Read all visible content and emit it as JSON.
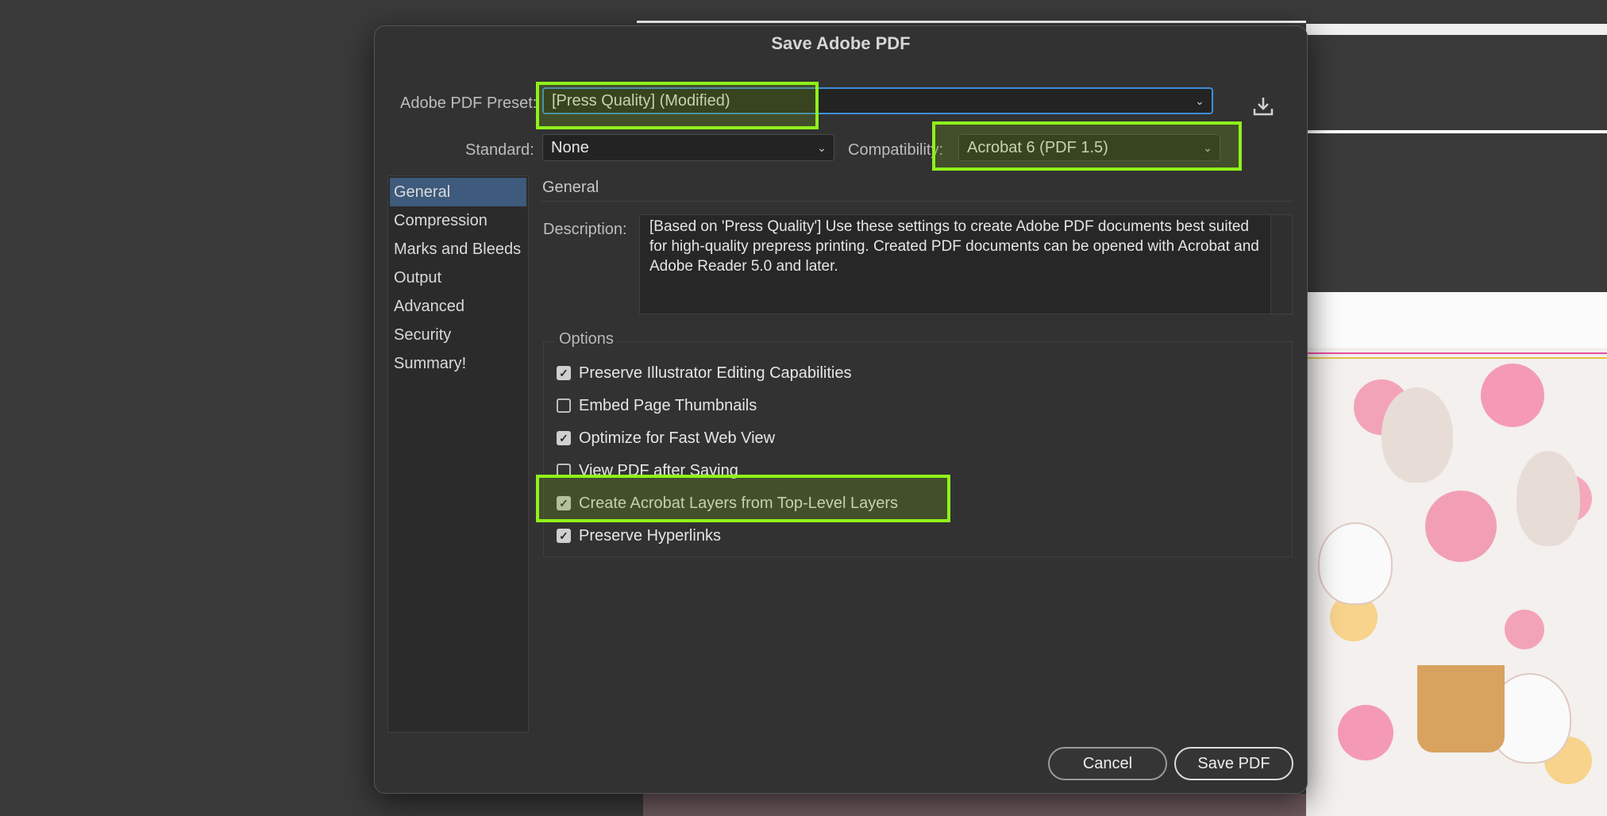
{
  "dialog": {
    "title": "Save Adobe PDF",
    "preset_label": "Adobe PDF Preset:",
    "preset_value": "[Press Quality] (Modified)",
    "standard_label": "Standard:",
    "standard_value": "None",
    "compatibility_label": "Compatibility:",
    "compatibility_value": "Acrobat 6 (PDF 1.5)",
    "save_preset_icon": "download-icon"
  },
  "sidebar": {
    "items": [
      {
        "label": "General",
        "active": true
      },
      {
        "label": "Compression"
      },
      {
        "label": "Marks and Bleeds"
      },
      {
        "label": "Output"
      },
      {
        "label": "Advanced"
      },
      {
        "label": "Security"
      },
      {
        "label": "Summary!"
      }
    ]
  },
  "main": {
    "section_title": "General",
    "description_label": "Description:",
    "description_text": "[Based on 'Press Quality'] Use these settings to create Adobe PDF documents best suited for high-quality prepress printing.  Created PDF documents can be opened with Acrobat and Adobe Reader 5.0 and later.",
    "options_title": "Options",
    "options": [
      {
        "label": "Preserve Illustrator Editing Capabilities",
        "checked": true
      },
      {
        "label": "Embed Page Thumbnails",
        "checked": false
      },
      {
        "label": "Optimize for Fast Web View",
        "checked": true
      },
      {
        "label": "View PDF after Saving",
        "checked": false
      },
      {
        "label": "Create Acrobat Layers from Top-Level Layers",
        "checked": true
      },
      {
        "label": "Preserve Hyperlinks",
        "checked": true
      }
    ]
  },
  "buttons": {
    "cancel": "Cancel",
    "save": "Save PDF"
  },
  "colors": {
    "highlight": "#8ff21a",
    "active_item": "#3e5a7c",
    "focus_border": "#3d8fd8"
  }
}
